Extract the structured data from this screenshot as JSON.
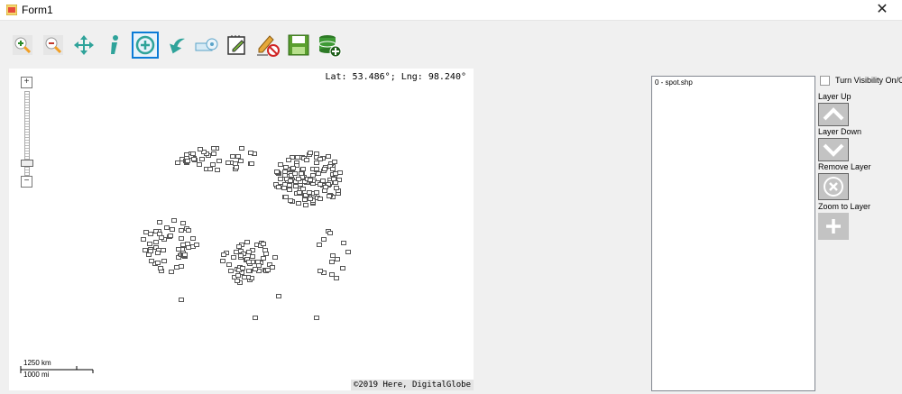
{
  "window": {
    "title": "Form1",
    "close_glyph": "✕"
  },
  "toolbar": {
    "buttons": [
      {
        "name": "zoom-in",
        "icon": "zoom-in-icon"
      },
      {
        "name": "zoom-out",
        "icon": "zoom-out-icon"
      },
      {
        "name": "pan",
        "icon": "pan-icon"
      },
      {
        "name": "identify",
        "icon": "info-icon"
      },
      {
        "name": "add-point",
        "icon": "add-point-icon",
        "selected": true
      },
      {
        "name": "back",
        "icon": "back-arrow-icon"
      },
      {
        "name": "measure",
        "icon": "measure-icon"
      },
      {
        "name": "edit",
        "icon": "edit-notes-icon"
      },
      {
        "name": "clear",
        "icon": "clear-icon"
      },
      {
        "name": "save",
        "icon": "save-icon"
      },
      {
        "name": "add-data",
        "icon": "database-add-icon"
      }
    ]
  },
  "map": {
    "coords": "Lat: 53.486°; Lng: 98.240°",
    "zoom_in": "+",
    "zoom_out": "−",
    "scale_km": "1250 km",
    "scale_mi": "1000 mi",
    "copyright": "©2019 Here, DigitalGlobe"
  },
  "layers": {
    "items": [
      "0 - spot.shp"
    ]
  },
  "controls": {
    "visibility_label": "Turn Visibility On/Off",
    "layer_up": "Layer Up",
    "layer_down": "Layer Down",
    "remove_layer": "Remove Layer",
    "zoom_to_layer": "Zoom to Layer"
  },
  "colors": {
    "accent": "#0b7bd6",
    "button_gray": "#c3c3c3"
  }
}
